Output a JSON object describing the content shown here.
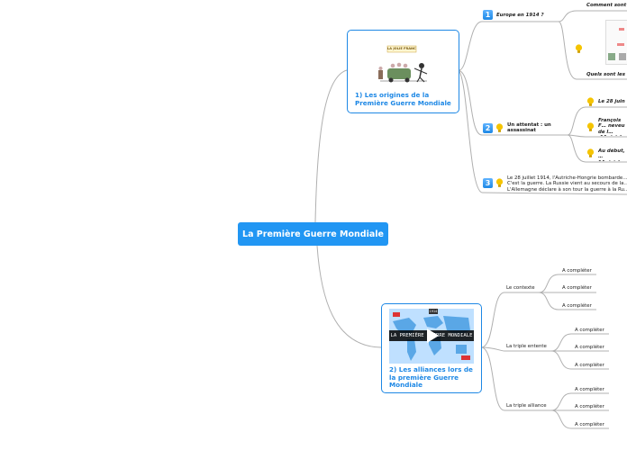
{
  "root": {
    "label": "La Première Guerre Mondiale"
  },
  "card1": {
    "title": "1) Les origines de la Première Guerre Mondiale",
    "image_caption": "LA JOLIE FRANCE"
  },
  "card2": {
    "title": "2) Les alliances lors de la première Guerre Mondiale",
    "video_title": "LA PREMIÈRE GUERRE MONDIALE",
    "video_tag": "1914"
  },
  "branch1": {
    "n1": {
      "badge": "1",
      "label": "Europe en 1914 ?"
    },
    "n1_children": {
      "top": "Comment sont",
      "bottom": "Quels sont les"
    },
    "n2": {
      "badge": "2",
      "label": "Un attentat : un assassinat"
    },
    "n2_children": [
      "Le 28 juin",
      "François F… neveu de l… d'Autriche…",
      "Au début, … l'Autriche-…"
    ],
    "n3": {
      "badge": "3",
      "lines": [
        "Le 28 juillet 1914, l'Autriche-Hongrie bombarde…",
        "C'est la guerre. La Russie vient au secours de la…",
        "L'Allemagne déclare à son tour la guerre à la Ru…"
      ]
    }
  },
  "branch2": {
    "groups": [
      {
        "label": "Le contexte",
        "items": [
          "A compléter",
          "A compléter",
          "A compléter"
        ]
      },
      {
        "label": "La triple entente",
        "items": [
          "A compléter",
          "A compléter",
          "A compléter"
        ]
      },
      {
        "label": "La triple alliance",
        "items": [
          "A compléter",
          "A compléter",
          "A compléter"
        ]
      }
    ]
  },
  "colors": {
    "accent": "#2196f3",
    "border": "#1e88e5",
    "link": "#a9a9a9",
    "bulb": "#f5c400"
  }
}
